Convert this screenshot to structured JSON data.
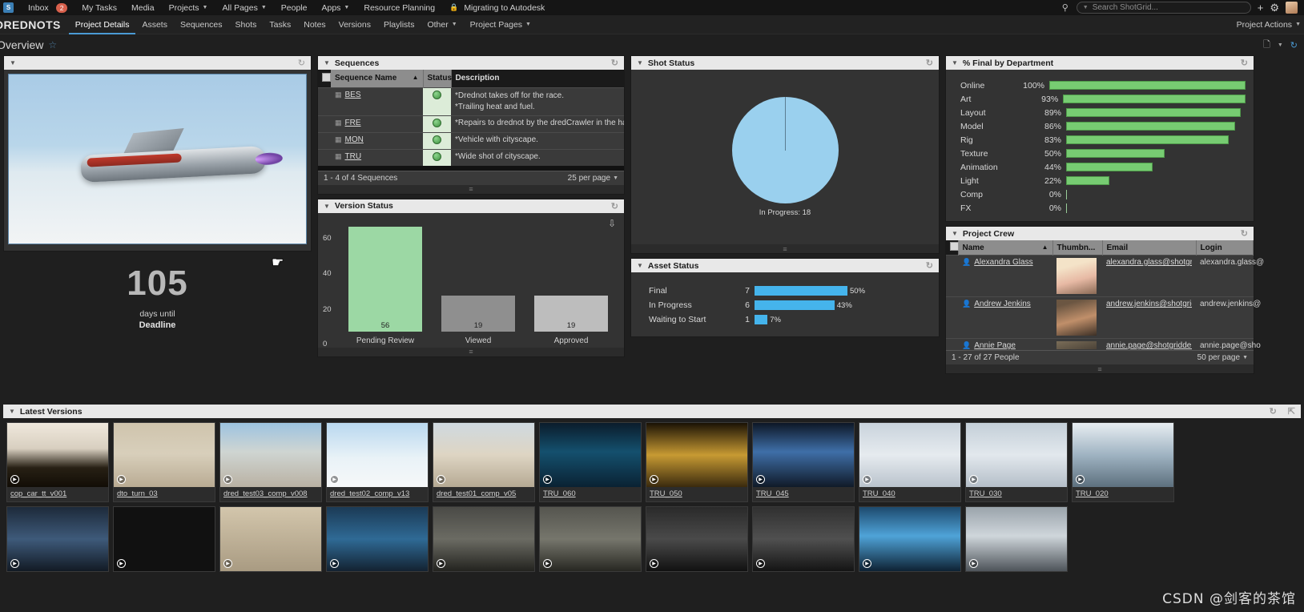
{
  "topnav": {
    "logo": "S",
    "items": [
      {
        "label": "Inbox",
        "badge": "2",
        "caret": false
      },
      {
        "label": "My Tasks",
        "caret": false
      },
      {
        "label": "Media",
        "caret": false
      },
      {
        "label": "Projects",
        "caret": true
      },
      {
        "label": "All Pages",
        "caret": true
      },
      {
        "label": "People",
        "caret": false
      },
      {
        "label": "Apps",
        "caret": true
      },
      {
        "label": "Resource Planning",
        "caret": false
      },
      {
        "label": "Migrating to Autodesk",
        "caret": false,
        "lock": true
      }
    ],
    "search_placeholder": "Search ShotGrid...",
    "add_icon": "+",
    "gear_icon": "⚙"
  },
  "projectbar": {
    "project_name": "DREDNOTS",
    "tabs": [
      {
        "label": "Project Details",
        "active": true
      },
      {
        "label": "Assets",
        "active": false
      },
      {
        "label": "Sequences",
        "active": false
      },
      {
        "label": "Shots",
        "active": false
      },
      {
        "label": "Tasks",
        "active": false
      },
      {
        "label": "Notes",
        "active": false
      },
      {
        "label": "Versions",
        "active": false
      },
      {
        "label": "Playlists",
        "active": false
      },
      {
        "label": "Other",
        "active": false,
        "caret": true
      },
      {
        "label": "Project Pages",
        "active": false,
        "caret": true
      }
    ],
    "actions_label": "Project Actions"
  },
  "page": {
    "title": "Overview",
    "star_icon": "☆"
  },
  "countdown": {
    "days": "105",
    "sub": "days until",
    "label": "Deadline"
  },
  "sequences": {
    "title": "Sequences",
    "columns": [
      "Sequence Name",
      "Status",
      "Description"
    ],
    "rows": [
      {
        "name": "BES",
        "status": "hold",
        "description": "*Drednot takes off for the race.\n*Trailing heat and fuel."
      },
      {
        "name": "FRE",
        "status": "hold",
        "description": "*Repairs to drednot by the dredCrawler in the han"
      },
      {
        "name": "MON",
        "status": "hold",
        "description": "*Vehicle with cityscape."
      },
      {
        "name": "TRU",
        "status": "hold",
        "description": "*Wide shot of cityscape."
      }
    ],
    "footer_count": "1 - 4 of 4 Sequences",
    "per_page": "25 per page"
  },
  "version_status": {
    "title": "Version Status",
    "chart_data": {
      "type": "bar",
      "title": "Version Status",
      "categories": [
        "Pending Review",
        "Viewed",
        "Approved"
      ],
      "values": [
        56,
        19,
        19
      ],
      "colors": [
        "#9cd8a4",
        "#8f8f8f",
        "#bdbdbd"
      ],
      "ylim": [
        0,
        60
      ],
      "yticks": [
        0,
        20,
        40,
        60
      ],
      "xlabel": "",
      "ylabel": ""
    }
  },
  "shot_status": {
    "title": "Shot Status",
    "chart_data": {
      "type": "pie",
      "title": "Shot Status",
      "labels": [
        "In Progress"
      ],
      "values": [
        18
      ],
      "colors": [
        "#9ad0ee"
      ],
      "annotation": "In Progress: 18",
      "legend": "none"
    }
  },
  "asset_status": {
    "title": "Asset Status",
    "chart_data": {
      "type": "bar",
      "orientation": "horizontal",
      "title": "Asset Status",
      "categories": [
        "Final",
        "In Progress",
        "Waiting to Start"
      ],
      "values": [
        7,
        6,
        1
      ],
      "percents": [
        "50%",
        "43%",
        "7%"
      ],
      "percent_values": [
        50,
        43,
        7
      ],
      "color": "#45b4ec"
    }
  },
  "dept_final": {
    "title": "% Final by Department",
    "chart_data": {
      "type": "bar",
      "orientation": "horizontal",
      "title": "% Final by Department",
      "categories": [
        "Online",
        "Art",
        "Layout",
        "Model",
        "Rig",
        "Texture",
        "Animation",
        "Light",
        "Comp",
        "FX"
      ],
      "values": [
        100,
        93,
        89,
        86,
        83,
        50,
        44,
        22,
        0,
        0
      ],
      "labels": [
        "100%",
        "93%",
        "89%",
        "86%",
        "83%",
        "50%",
        "44%",
        "22%",
        "0%",
        "0%"
      ],
      "color": "#77cc72",
      "xlim": [
        0,
        100
      ]
    }
  },
  "project_crew": {
    "title": "Project Crew",
    "columns": [
      "Name",
      "Thumbn...",
      "Email",
      "Login"
    ],
    "rows": [
      {
        "name": "Alexandra Glass",
        "email": "alexandra.glass@shotgridde...",
        "login": "alexandra.glass@",
        "av": "blonde"
      },
      {
        "name": "Andrew Jenkins",
        "email": "andrew.jenkins@shotgriddem...",
        "login": "andrew.jenkins@",
        "av": "man"
      },
      {
        "name": "Annie Page",
        "email": "annie.page@shotgriddemo.co...",
        "login": "annie.page@sho",
        "av": "woman2"
      }
    ],
    "footer_count": "1 - 27 of 27 People",
    "per_page": "50 per page"
  },
  "latest_versions": {
    "title": "Latest Versions",
    "row1": [
      {
        "name": "cop_car_tt_v001",
        "thumb": "desert-dark"
      },
      {
        "name": "dto_turn_03",
        "thumb": "ship-red"
      },
      {
        "name": "dred_test03_comp_v008",
        "thumb": "desert-sun"
      },
      {
        "name": "dred_test02_comp_v13",
        "thumb": "snow-ship"
      },
      {
        "name": "dred_test01_comp_v05",
        "thumb": "desert-wide"
      },
      {
        "name": "TRU_060",
        "thumb": "city-night"
      },
      {
        "name": "TRU_050",
        "thumb": "city-gold"
      },
      {
        "name": "TRU_045",
        "thumb": "city-blue"
      },
      {
        "name": "TRU_040",
        "thumb": "clouds-ship"
      },
      {
        "name": "TRU_030",
        "thumb": "clouds-ship2"
      },
      {
        "name": "TRU_020",
        "thumb": "ice-crystal"
      }
    ],
    "row2": [
      {
        "thumb": "city-dusk"
      },
      {
        "thumb": "desert-pan"
      },
      {
        "thumb": "desert-pan2"
      },
      {
        "thumb": "blue-interior"
      },
      {
        "thumb": "hangar"
      },
      {
        "thumb": "hangar2"
      },
      {
        "thumb": "dark-room"
      },
      {
        "thumb": "dark-room2"
      },
      {
        "thumb": "ship-blue"
      },
      {
        "thumb": "ship-silver"
      }
    ]
  },
  "watermark": "CSDN @剑客的茶馆"
}
